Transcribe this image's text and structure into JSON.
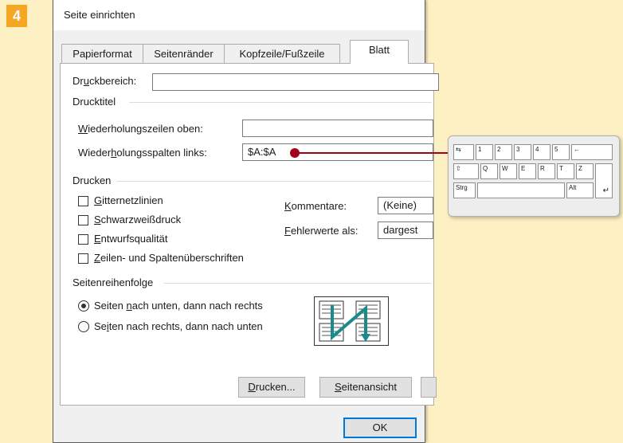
{
  "step": "4",
  "dialog": {
    "title": "Seite einrichten",
    "tabs": [
      {
        "label": "Papierformat"
      },
      {
        "label": "Seitenränder"
      },
      {
        "label": "Kopfzeile/Fußzeile"
      },
      {
        "label": "Blatt",
        "active": true
      }
    ],
    "druckbereich": {
      "label_u": "u",
      "label_pre": "Dr",
      "label_post": "ckbereich:",
      "value": ""
    },
    "drucktitel": {
      "heading": "Drucktitel",
      "zeilen": {
        "label_u": "W",
        "label_rest": "iederholungszeilen oben:",
        "value": ""
      },
      "spalten": {
        "label_pre": "Wieder",
        "label_u": "h",
        "label_post": "olungsspalten links:",
        "value": "$A:$A"
      }
    },
    "drucken": {
      "heading": "Drucken",
      "checkboxes": [
        {
          "u": "G",
          "rest": "itternetzlinien"
        },
        {
          "u": "S",
          "rest": "chwarzweißdruck"
        },
        {
          "u": "E",
          "rest": "ntwurfsqualität"
        },
        {
          "u": "Z",
          "rest": "eilen- und Spaltenüberschriften"
        }
      ],
      "kommentare": {
        "label_u": "K",
        "label_rest": "ommentare:",
        "value": "(Keine)"
      },
      "fehlerwerte": {
        "label_u": "F",
        "label_rest": "ehlerwerte als:",
        "value": "dargest"
      }
    },
    "reihenfolge": {
      "heading": "Seitenreihenfolge",
      "opt1": {
        "pre": "Seiten ",
        "u": "n",
        "post": "ach unten, dann nach rechts",
        "checked": true
      },
      "opt2": {
        "pre": "Se",
        "u": "i",
        "post": "ten nach rechts, dann nach unten",
        "checked": false
      }
    },
    "buttons": {
      "drucken_u": "D",
      "drucken_rest": "rucken...",
      "ansicht_u": "S",
      "ansicht_rest": "eitenansicht",
      "ok": "OK"
    }
  },
  "keyboard": {
    "row1": [
      "1",
      "2",
      "3",
      "4",
      "5",
      "←"
    ],
    "row2": [
      "⇧",
      "Q",
      "W",
      "E",
      "R",
      "T",
      "Z"
    ],
    "row3": [
      "Strg",
      "Alt",
      "↵"
    ],
    "tab": "⇆"
  },
  "colors": {
    "callout": "#a4001d",
    "accent": "#f5a623",
    "background": "#fdf0c2"
  }
}
